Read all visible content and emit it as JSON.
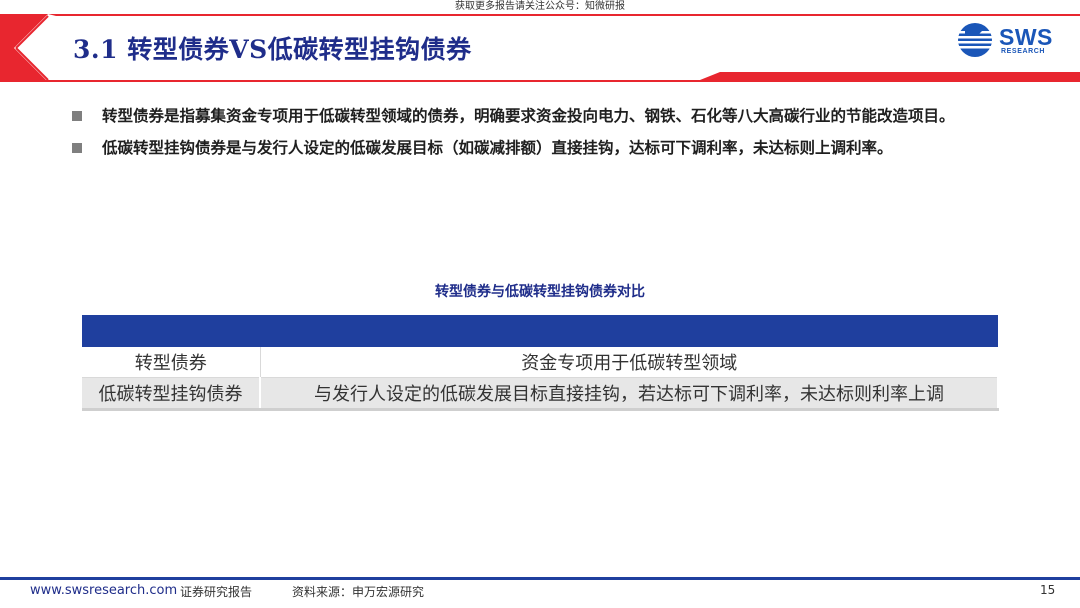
{
  "header": {
    "top_note": "获取更多报告请关注公众号：知微研报",
    "title": "3.1 转型债券VS低碳转型挂钩债券"
  },
  "logo": {
    "name": "SWS",
    "sub": "RESEARCH",
    "color": "#1a56b8"
  },
  "bullets": [
    {
      "text": "转型债券是指募集资金专项用于低碳转型领域的债券，明确要求资金投向电力、钢铁、石化等八大高碳行业的节能改造项目。"
    },
    {
      "text": "低碳转型挂钩债券是与发行人设定的低碳发展目标（如碳减排额）直接挂钩，达标可下调利率，未达标则上调利率。"
    }
  ],
  "table": {
    "caption": "转型债券与低碳转型挂钩债券对比",
    "header_color": "#1f3f9e",
    "rows": [
      {
        "name": "转型债券",
        "desc": "资金专项用于低碳转型领域"
      },
      {
        "name": "低碳转型挂钩债券",
        "desc": "与发行人设定的低碳发展目标直接挂钩，若达标可下调利率，未达标则利率上调"
      }
    ]
  },
  "footer": {
    "url": "www.swsresearch.com",
    "tag": "证券研究报告",
    "source": "资料来源：申万宏源研究",
    "page": "15"
  },
  "colors": {
    "accent_red": "#e8262f",
    "navy": "#1f2d8a"
  }
}
